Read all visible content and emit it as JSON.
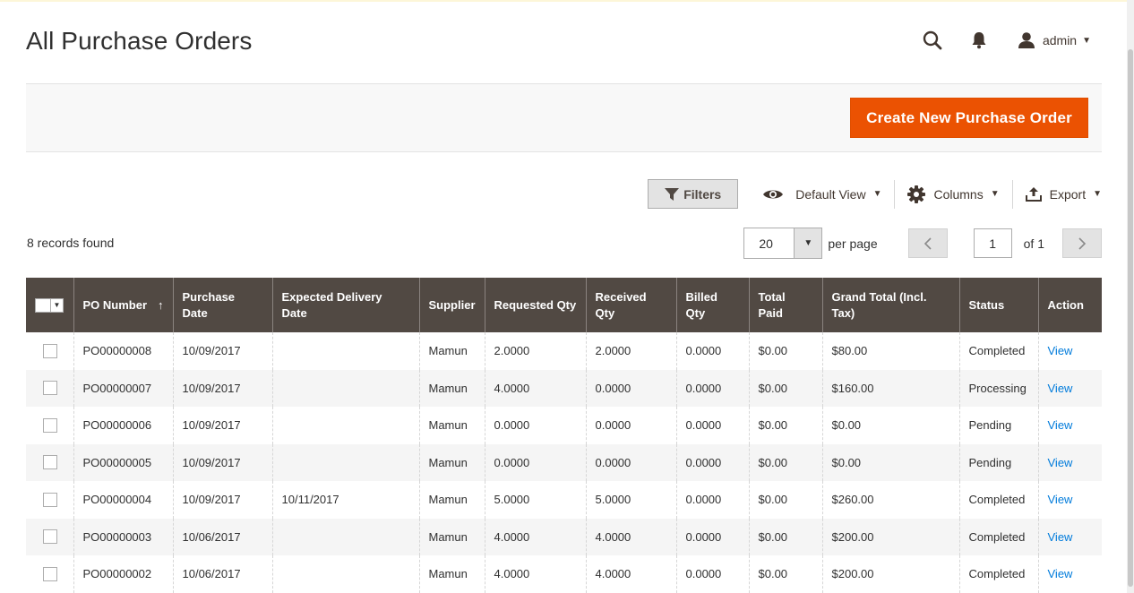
{
  "page": {
    "title": "All Purchase Orders"
  },
  "header": {
    "user_label": "admin"
  },
  "action_bar": {
    "create_button": "Create New Purchase Order"
  },
  "toolbar": {
    "filters": "Filters",
    "view": "Default View",
    "columns": "Columns",
    "export": "Export"
  },
  "records_found": "8 records found",
  "pager": {
    "per_page_value": "20",
    "per_page_label": "per page",
    "current_page": "1",
    "of_pages": "of 1"
  },
  "grid": {
    "headers": {
      "po_number": "PO Number",
      "purchase_date": "Purchase Date",
      "expected_delivery": "Expected Delivery Date",
      "supplier": "Supplier",
      "requested_qty": "Requested Qty",
      "received_qty": "Received Qty",
      "billed_qty": "Billed Qty",
      "total_paid": "Total Paid",
      "grand_total": "Grand Total (Incl. Tax)",
      "status": "Status",
      "action": "Action"
    },
    "rows": [
      {
        "po": "PO00000008",
        "date": "10/09/2017",
        "expected": "",
        "supplier": "Mamun",
        "requested": "2.0000",
        "received": "2.0000",
        "billed": "0.0000",
        "paid": "$0.00",
        "grand": "$80.00",
        "status": "Completed",
        "action": "View"
      },
      {
        "po": "PO00000007",
        "date": "10/09/2017",
        "expected": "",
        "supplier": "Mamun",
        "requested": "4.0000",
        "received": "0.0000",
        "billed": "0.0000",
        "paid": "$0.00",
        "grand": "$160.00",
        "status": "Processing",
        "action": "View"
      },
      {
        "po": "PO00000006",
        "date": "10/09/2017",
        "expected": "",
        "supplier": "Mamun",
        "requested": "0.0000",
        "received": "0.0000",
        "billed": "0.0000",
        "paid": "$0.00",
        "grand": "$0.00",
        "status": "Pending",
        "action": "View"
      },
      {
        "po": "PO00000005",
        "date": "10/09/2017",
        "expected": "",
        "supplier": "Mamun",
        "requested": "0.0000",
        "received": "0.0000",
        "billed": "0.0000",
        "paid": "$0.00",
        "grand": "$0.00",
        "status": "Pending",
        "action": "View"
      },
      {
        "po": "PO00000004",
        "date": "10/09/2017",
        "expected": "10/11/2017",
        "supplier": "Mamun",
        "requested": "5.0000",
        "received": "5.0000",
        "billed": "0.0000",
        "paid": "$0.00",
        "grand": "$260.00",
        "status": "Completed",
        "action": "View"
      },
      {
        "po": "PO00000003",
        "date": "10/06/2017",
        "expected": "",
        "supplier": "Mamun",
        "requested": "4.0000",
        "received": "4.0000",
        "billed": "0.0000",
        "paid": "$0.00",
        "grand": "$200.00",
        "status": "Completed",
        "action": "View"
      },
      {
        "po": "PO00000002",
        "date": "10/06/2017",
        "expected": "",
        "supplier": "Mamun",
        "requested": "4.0000",
        "received": "4.0000",
        "billed": "0.0000",
        "paid": "$0.00",
        "grand": "$200.00",
        "status": "Completed",
        "action": "View"
      }
    ]
  }
}
